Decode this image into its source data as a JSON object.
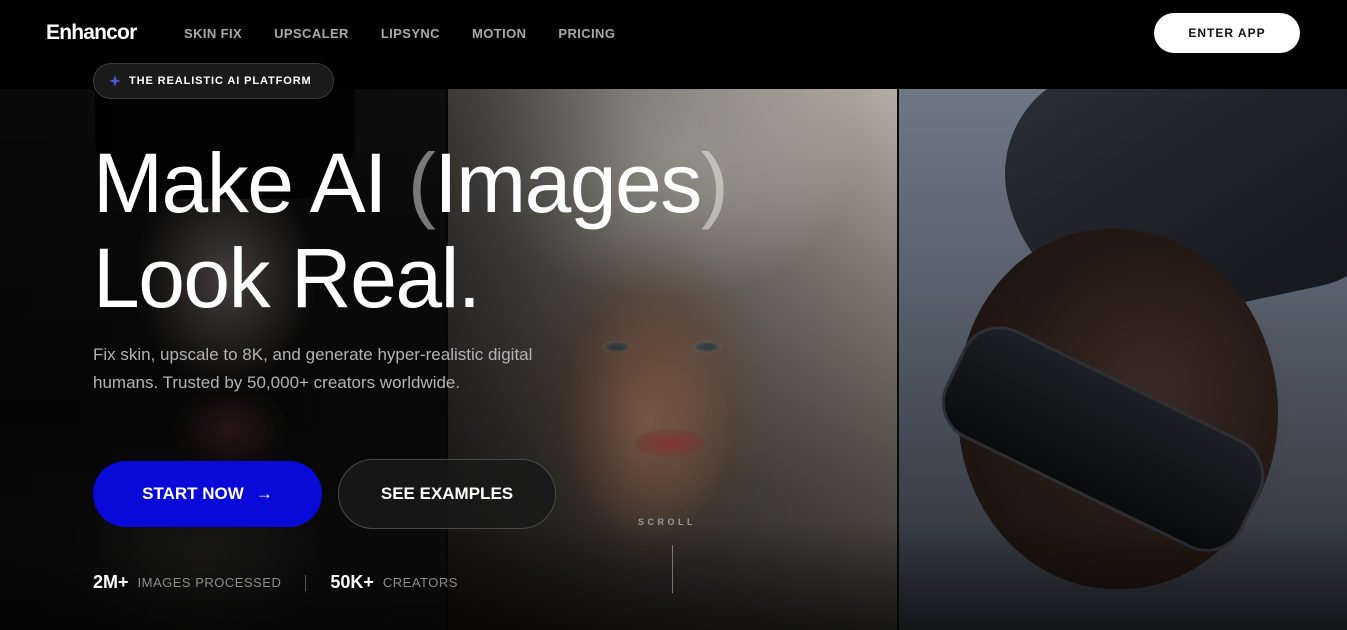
{
  "nav": {
    "logo": "Enhancor",
    "links": [
      "SKIN FIX",
      "UPSCALER",
      "LIPSYNC",
      "MOTION",
      "PRICING"
    ],
    "enter_app": "ENTER APP"
  },
  "hero": {
    "badge_icon": "sparkle-icon",
    "badge": "THE REALISTIC AI PLATFORM",
    "headline_part1": "Make AI ",
    "headline_paren_open": "(",
    "headline_highlight": "Images",
    "headline_paren_close": ")",
    "headline_line2": "Look Real.",
    "subtext": "Fix skin, upscale to 8K, and generate hyper-realistic digital humans. Trusted by 50,000+ creators worldwide.",
    "start_button": "START NOW",
    "start_arrow": "→",
    "examples_button": "SEE EXAMPLES",
    "stats": [
      {
        "value": "2M+",
        "label": "IMAGES PROCESSED"
      },
      {
        "value": "50K+",
        "label": "CREATORS"
      }
    ],
    "scroll": "SCROLL"
  },
  "colors": {
    "primary_button": "#0a0ad8",
    "background": "#000000",
    "muted_text": "#b3b3b3"
  }
}
